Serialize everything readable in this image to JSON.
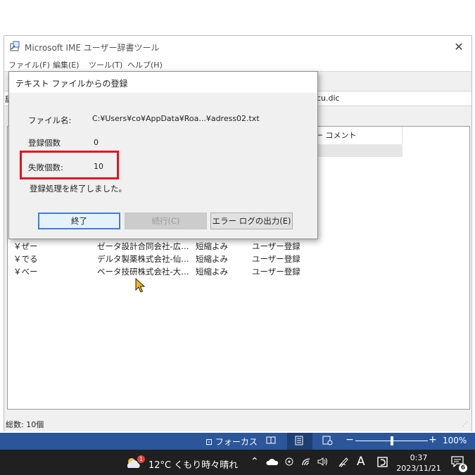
{
  "window": {
    "title": "Microsoft IME ユーザー辞書ツール",
    "menu": [
      "ファイル(F)",
      "編集(E)",
      "ツール(T)",
      "ヘルプ(H)"
    ],
    "path_left": "辞",
    "path_suffix": "cu.dic",
    "columns": [
      "ザー コメント"
    ],
    "rows": [
      {
        "reading": "￥ぜー",
        "word": "ゼータ設計合同会社-広…",
        "type": "短縮よみ",
        "user": "ユーザー登録"
      },
      {
        "reading": "￥でる",
        "word": "デルタ製薬株式会社-仙…",
        "type": "短縮よみ",
        "user": "ユーザー登録"
      },
      {
        "reading": "￥べー",
        "word": "ベータ技研株式会社-大…",
        "type": "短縮よみ",
        "user": "ユーザー登録"
      }
    ],
    "status": "総数: 10個"
  },
  "dialog": {
    "title": "テキスト ファイルからの登録",
    "file_label": "ファイル名:",
    "file_value": "C:¥Users¥co¥AppData¥Roa...¥adress02.txt",
    "registered_label": "登録個数",
    "registered_value": "0",
    "failed_label": "失敗個数:",
    "failed_value": "10",
    "message": "登録処理を終了しました。",
    "btn_finish": "終了",
    "btn_continue": "続行(C)",
    "btn_errorlog": "エラー ログの出力(E)"
  },
  "word_bar": {
    "focus": "フォーカス",
    "zoom_minus": "−",
    "zoom_plus": "+",
    "zoom_level": "100%",
    "zoom_fraction": 0.5
  },
  "taskbar": {
    "weather_badge": "1",
    "weather": "12°C くもり時々晴れ",
    "ime": "A",
    "time": "0:37",
    "date": "2023/11/21",
    "notif_count": "6"
  },
  "colors": {
    "highlight": "#e0111f",
    "word_blue": "#2b579a",
    "taskbar": "#202020"
  }
}
